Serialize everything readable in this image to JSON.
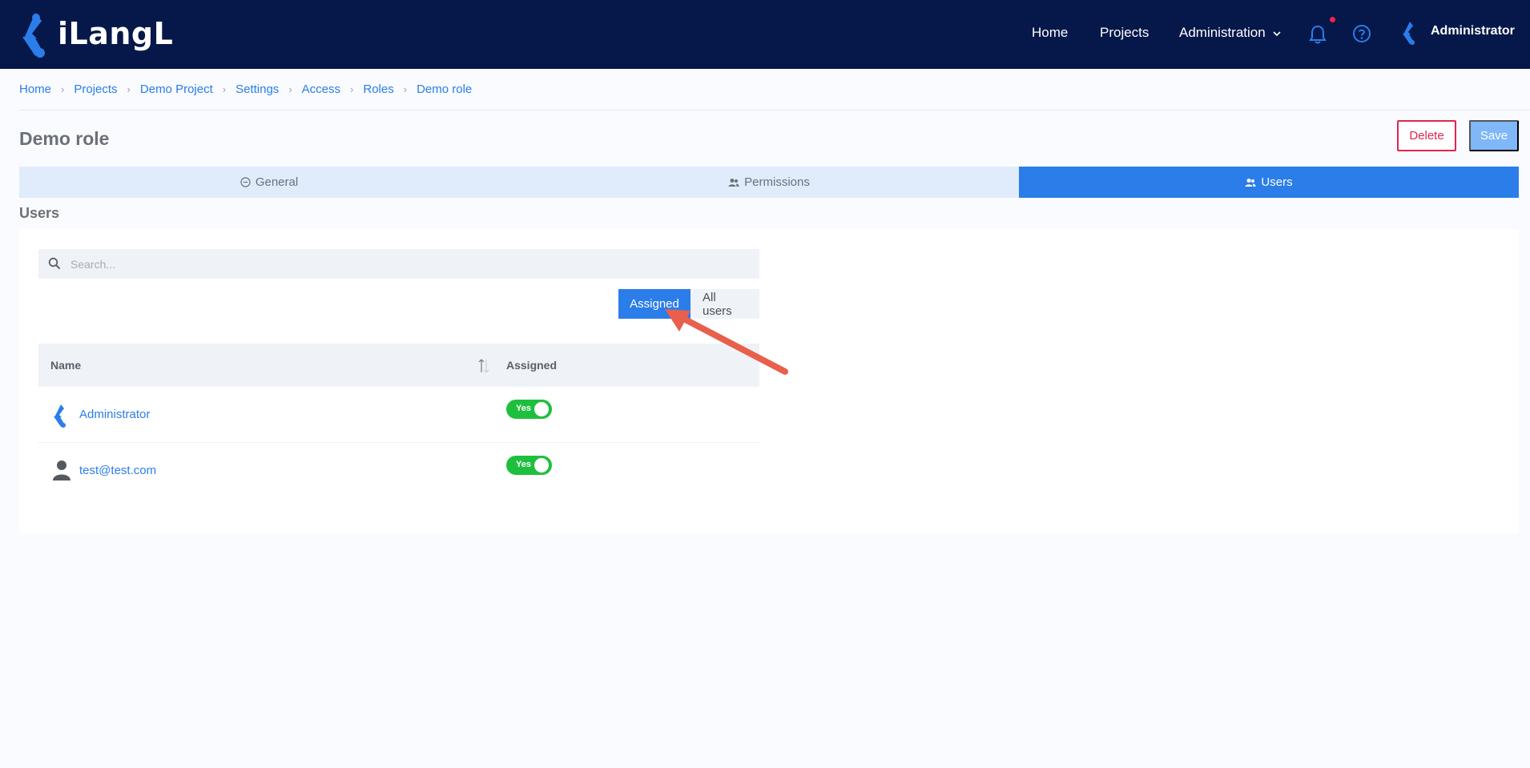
{
  "app": {
    "logo_text": "iLangL"
  },
  "nav": {
    "home": "Home",
    "projects": "Projects",
    "administration": "Administration",
    "user_name": "Administrator"
  },
  "breadcrumb": [
    "Home",
    "Projects",
    "Demo Project",
    "Settings",
    "Access",
    "Roles",
    "Demo role"
  ],
  "page": {
    "title": "Demo role",
    "delete_label": "Delete",
    "save_label": "Save"
  },
  "tabs": [
    {
      "label": "General",
      "icon": "minus-circle-icon",
      "active": false
    },
    {
      "label": "Permissions",
      "icon": "users-icon",
      "active": false
    },
    {
      "label": "Users",
      "icon": "users-icon",
      "active": true
    }
  ],
  "section": {
    "title": "Users"
  },
  "search": {
    "placeholder": "Search...",
    "value": ""
  },
  "filter": {
    "assigned": "Assigned",
    "all_users": "All users",
    "selected": "Assigned"
  },
  "table": {
    "columns": [
      "Name",
      "Assigned"
    ],
    "rows": [
      {
        "name": "Administrator",
        "avatar": "ilangl-logo-icon",
        "assigned": "Yes"
      },
      {
        "name": "test@test.com",
        "avatar": "person-icon",
        "assigned": "Yes"
      }
    ]
  },
  "colors": {
    "navbar": "#06184a",
    "accent": "#2b7de9",
    "danger": "#e0254d",
    "toggle_on": "#1fbf3e",
    "annotation_arrow": "#e8604c"
  }
}
